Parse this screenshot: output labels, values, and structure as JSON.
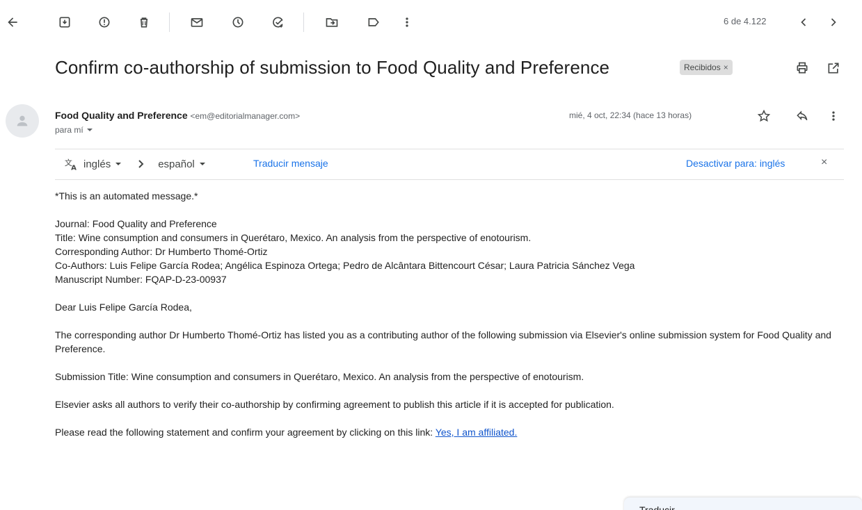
{
  "toolbar": {
    "counter": "6 de 4.122",
    "icons": [
      "back-arrow-icon",
      "archive-icon",
      "report-spam-icon",
      "delete-icon",
      "mark-unread-icon",
      "snooze-icon",
      "add-task-icon",
      "move-to-icon",
      "label-icon",
      "more-vert-icon",
      "newer-icon",
      "older-icon"
    ]
  },
  "subject": {
    "title": "Confirm co-authorship of submission to Food Quality and Preference",
    "label": "Recibidos",
    "label_close": "×"
  },
  "sender": {
    "name": "Food Quality and Preference",
    "email": "<em@editorialmanager.com>",
    "to": "para mí",
    "date": "mié, 4 oct, 22:34 (hace 13 horas)"
  },
  "translation": {
    "from_lang": "inglés",
    "to_lang": "español",
    "translate_link": "Traducir mensaje",
    "disable_link": "Desactivar para: inglés",
    "close": "×"
  },
  "body": {
    "line1": "*This is an automated message.*",
    "journal": "Journal: Food Quality and Preference",
    "title": "Title: Wine consumption and consumers in Querétaro, Mexico. An analysis from the perspective of enotourism.",
    "corresponding": "Corresponding Author: Dr Humberto Thomé-Ortiz",
    "coauthors": "Co-Authors: Luis Felipe García Rodea; Angélica Espinoza Ortega; Pedro de Alcântara Bittencourt César; Laura Patricia Sánchez Vega",
    "manuscript": "Manuscript Number: FQAP-D-23-00937",
    "greeting": "Dear Luis Felipe García Rodea,",
    "para1": "The corresponding author Dr Humberto Thomé-Ortiz has listed you as a contributing author of the following submission via Elsevier's online submission system for Food Quality and Preference.",
    "submission_title": "Submission Title: Wine consumption and consumers in Querétaro, Mexico. An analysis from the perspective of enotourism.",
    "para2": "Elsevier asks all authors to verify their co-authorship by confirming agreement to publish this article if it is accepted for publication.",
    "para3": "Please read the following statement and confirm your agreement by clicking on this link: ",
    "link": "Yes, I am affiliated."
  },
  "float_panel": {
    "label": "Traducir"
  },
  "colors": {
    "link": "#1155cc",
    "accent": "#1a73e8",
    "chip_bg": "#dddddd"
  }
}
